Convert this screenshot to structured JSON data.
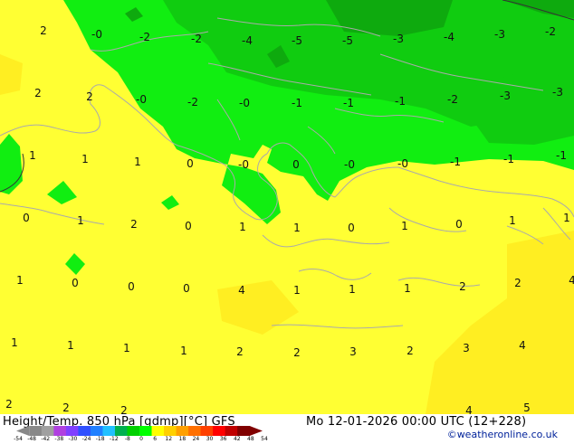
{
  "footer": {
    "title": "Height/Temp. 850 hPa [gdmp][°C] GFS",
    "datetime": "Mo 12-01-2026 00:00 UTC (12+228)",
    "credit": "©weatheronline.co.uk"
  },
  "colors": {
    "yellow": "#ffff33",
    "yellow_dark": "#ffee22",
    "green_light": "#11ee11",
    "green_mid": "#10cc10",
    "green_dark": "#0eaa0e",
    "border": "#aaaaaa",
    "contour": "#333333"
  },
  "scale": {
    "labels": [
      "-54",
      "-48",
      "-42",
      "-38",
      "-30",
      "-24",
      "-18",
      "-12",
      "-8",
      "0",
      "6",
      "12",
      "18",
      "24",
      "30",
      "36",
      "42",
      "48",
      "54"
    ],
    "colors": [
      "#888888",
      "#a0a0a0",
      "#b040e0",
      "#8040ff",
      "#3050ff",
      "#2080ff",
      "#20c0ff",
      "#00b050",
      "#00d000",
      "#00ff00",
      "#ffff00",
      "#ffd000",
      "#ffa000",
      "#ff7000",
      "#ff4000",
      "#ff0000",
      "#c00000",
      "#800000"
    ]
  },
  "map_labels": [
    {
      "text": "2",
      "id": "l1"
    },
    {
      "text": "-0",
      "id": "l2"
    },
    {
      "text": "-2",
      "id": "l3"
    },
    {
      "text": "-2",
      "id": "l4"
    },
    {
      "text": "-4",
      "id": "l5"
    },
    {
      "text": "-5",
      "id": "l6"
    },
    {
      "text": "-5",
      "id": "l7"
    },
    {
      "text": "-3",
      "id": "l8"
    },
    {
      "text": "-4",
      "id": "l9"
    },
    {
      "text": "-3",
      "id": "l10"
    },
    {
      "text": "-2",
      "id": "l11"
    },
    {
      "text": "2",
      "id": "l12"
    },
    {
      "text": "2",
      "id": "l13"
    },
    {
      "text": "-0",
      "id": "l14"
    },
    {
      "text": "-2",
      "id": "l15"
    },
    {
      "text": "-0",
      "id": "l16"
    },
    {
      "text": "-1",
      "id": "l17"
    },
    {
      "text": "-1",
      "id": "l18"
    },
    {
      "text": "-1",
      "id": "l19"
    },
    {
      "text": "-2",
      "id": "l20"
    },
    {
      "text": "-3",
      "id": "l21"
    },
    {
      "text": "-3",
      "id": "l22"
    },
    {
      "text": "1",
      "id": "l23"
    },
    {
      "text": "1",
      "id": "l24"
    },
    {
      "text": "1",
      "id": "l25"
    },
    {
      "text": "0",
      "id": "l26"
    },
    {
      "text": "-0",
      "id": "l27"
    },
    {
      "text": "0",
      "id": "l28"
    },
    {
      "text": "-0",
      "id": "l29"
    },
    {
      "text": "-0",
      "id": "l30"
    },
    {
      "text": "-1",
      "id": "l31"
    },
    {
      "text": "-1",
      "id": "l32"
    },
    {
      "text": "-1",
      "id": "l33"
    },
    {
      "text": "0",
      "id": "l34"
    },
    {
      "text": "1",
      "id": "l35"
    },
    {
      "text": "2",
      "id": "l36"
    },
    {
      "text": "0",
      "id": "l37"
    },
    {
      "text": "1",
      "id": "l38"
    },
    {
      "text": "1",
      "id": "l39"
    },
    {
      "text": "0",
      "id": "l40"
    },
    {
      "text": "1",
      "id": "l41"
    },
    {
      "text": "0",
      "id": "l42"
    },
    {
      "text": "1",
      "id": "l43"
    },
    {
      "text": "1",
      "id": "l44"
    },
    {
      "text": "1",
      "id": "l45"
    },
    {
      "text": "0",
      "id": "l46"
    },
    {
      "text": "0",
      "id": "l47"
    },
    {
      "text": "0",
      "id": "l48"
    },
    {
      "text": "4",
      "id": "l49"
    },
    {
      "text": "1",
      "id": "l50"
    },
    {
      "text": "1",
      "id": "l51"
    },
    {
      "text": "1",
      "id": "l52"
    },
    {
      "text": "2",
      "id": "l53"
    },
    {
      "text": "2",
      "id": "l54"
    },
    {
      "text": "4",
      "id": "l55"
    },
    {
      "text": "1",
      "id": "l56"
    },
    {
      "text": "1",
      "id": "l57"
    },
    {
      "text": "1",
      "id": "l58"
    },
    {
      "text": "1",
      "id": "l59"
    },
    {
      "text": "2",
      "id": "l60"
    },
    {
      "text": "2",
      "id": "l61"
    },
    {
      "text": "3",
      "id": "l62"
    },
    {
      "text": "2",
      "id": "l63"
    },
    {
      "text": "3",
      "id": "l64"
    },
    {
      "text": "4",
      "id": "l65"
    },
    {
      "text": "2",
      "id": "l66"
    },
    {
      "text": "2",
      "id": "l67"
    },
    {
      "text": "2",
      "id": "l68"
    },
    {
      "text": "4",
      "id": "l69"
    },
    {
      "text": "5",
      "id": "l70"
    }
  ]
}
